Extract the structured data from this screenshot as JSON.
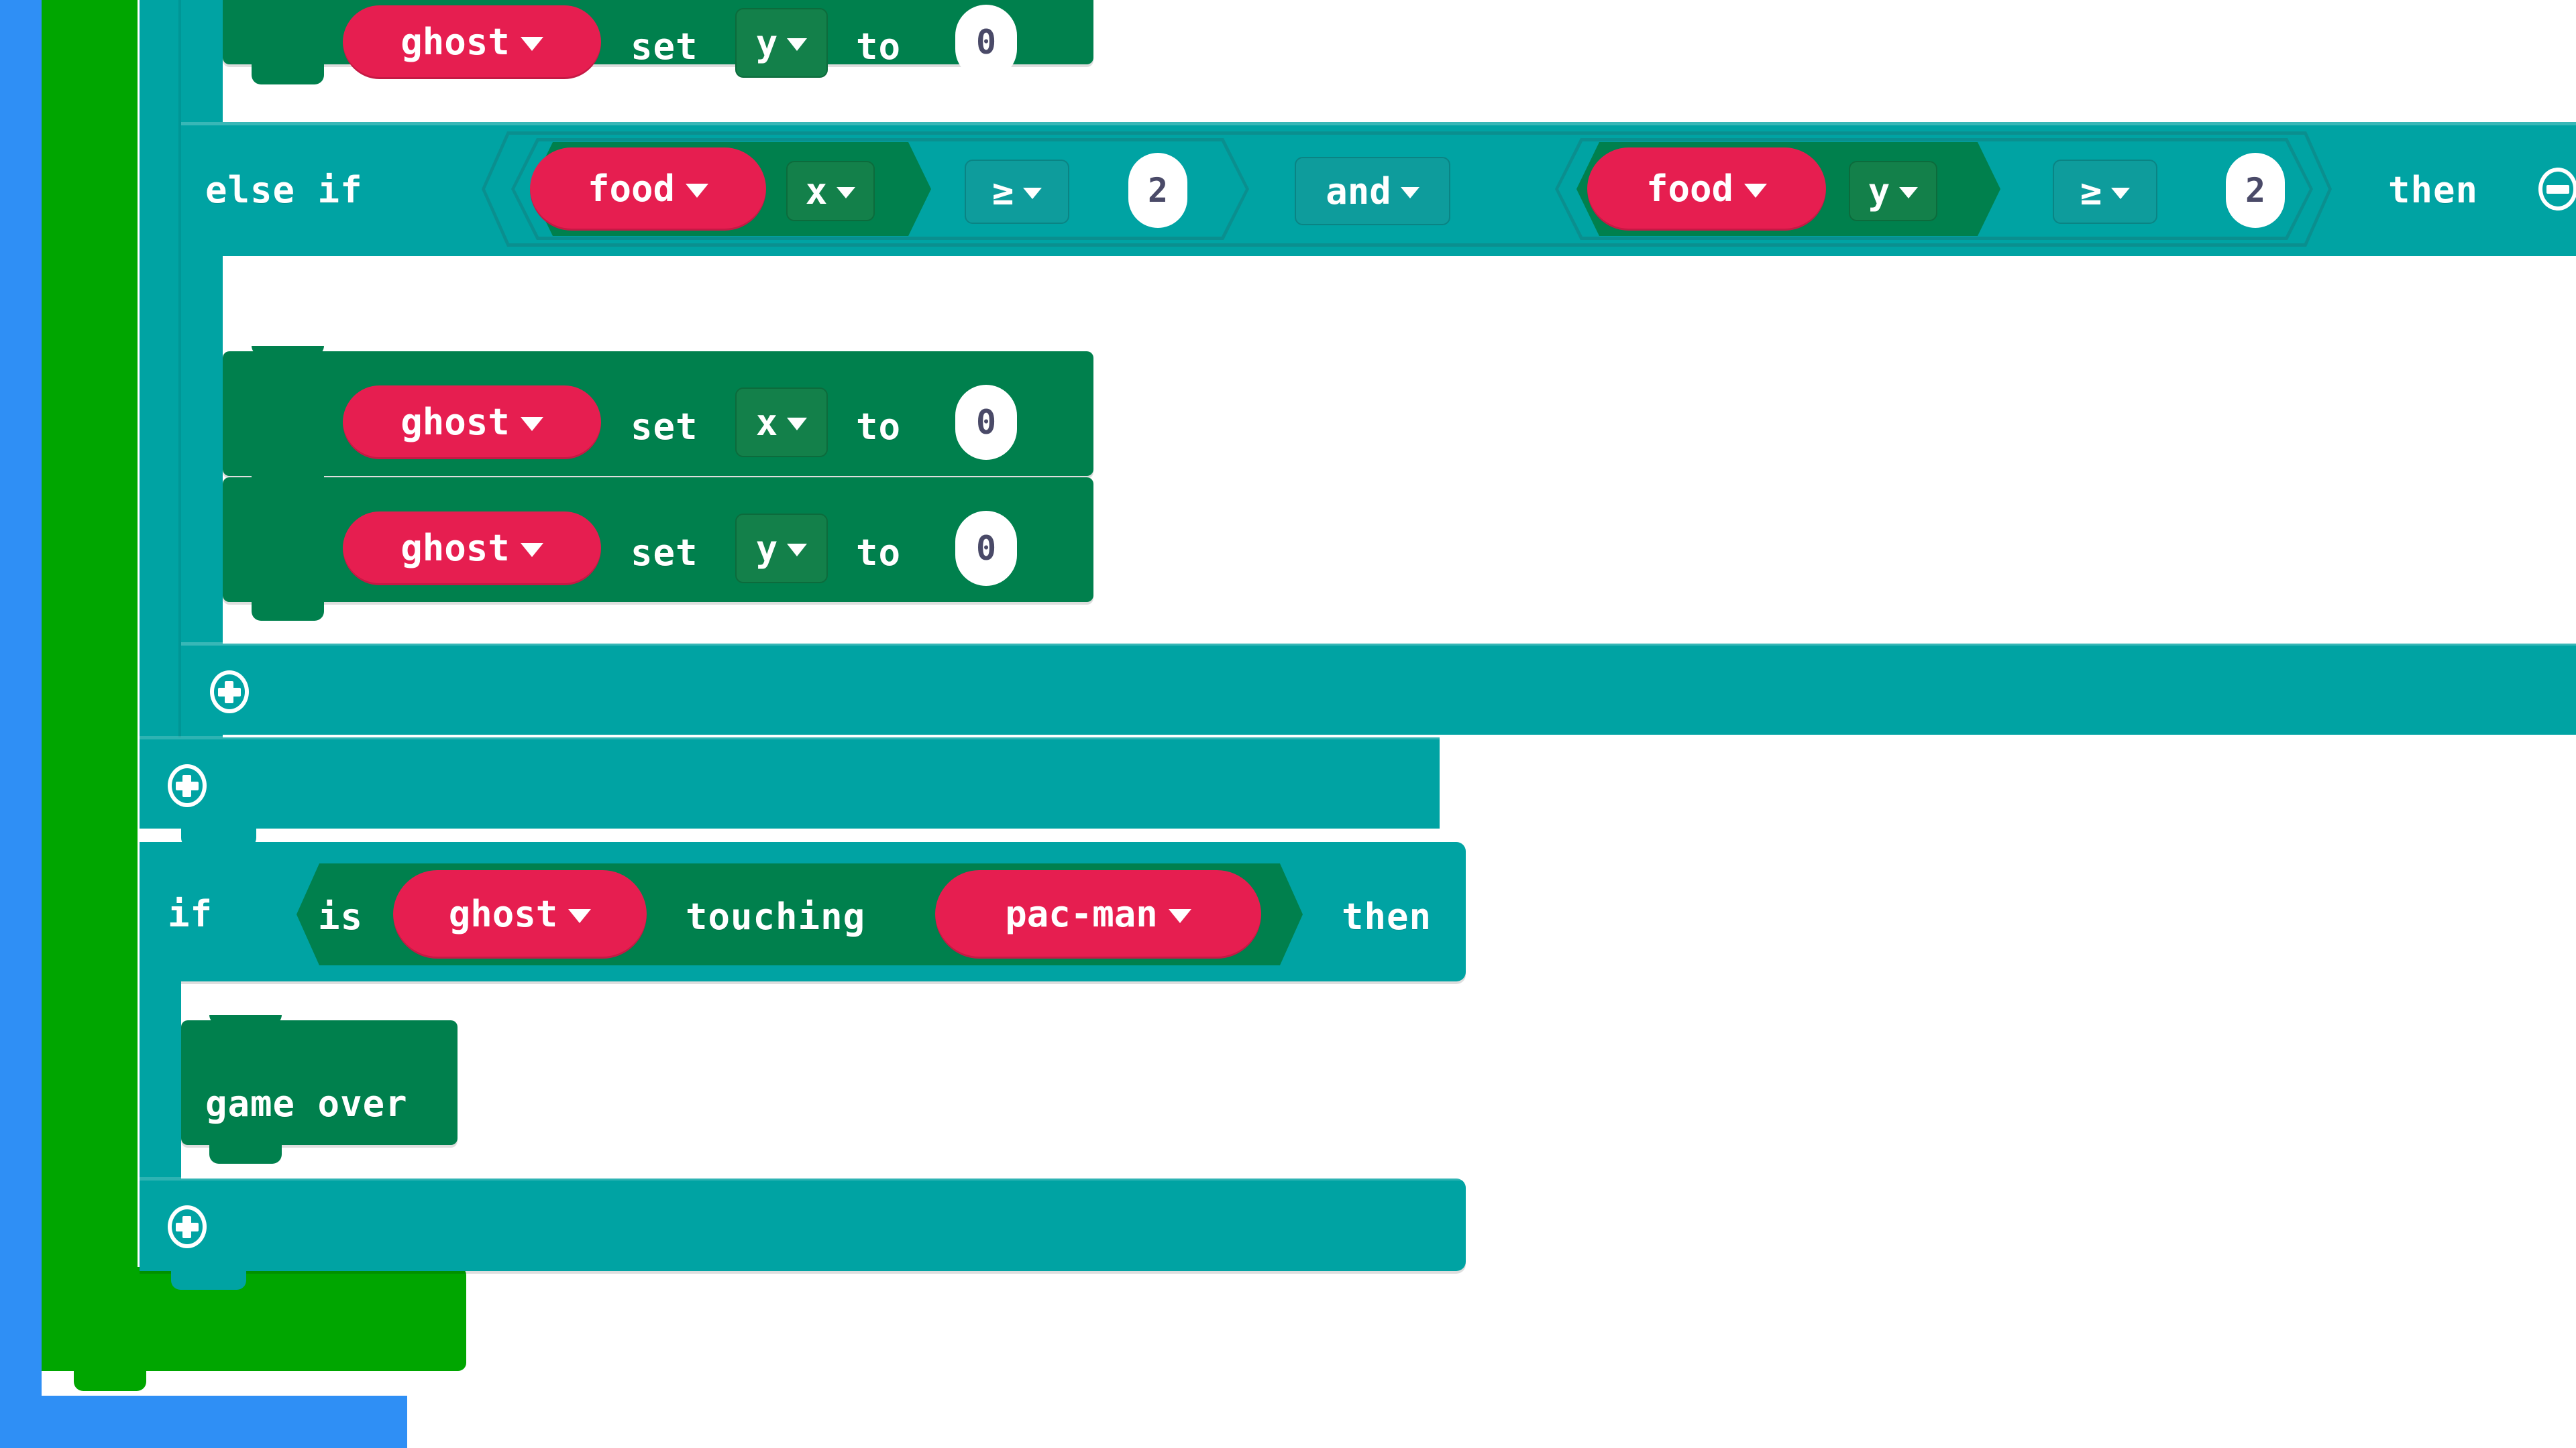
{
  "editor": {
    "name": "block-code-workspace",
    "colors": {
      "control_teal": "#00A3A3",
      "sprite_green": "#00804D",
      "loop_green": "#00A600",
      "event_blue": "#2F8FF5",
      "variable_red": "#E61E50",
      "field_white": "#FFFFFF",
      "number_text": "#4A4A68"
    }
  },
  "blocks": {
    "row_set_y_top": {
      "var": "ghost",
      "set_label": "set",
      "prop": "y",
      "to_label": "to",
      "value": "0"
    },
    "else_if_row": {
      "keyword": "else if",
      "then_label": "then",
      "remove_icon": "minus-circle-icon",
      "operand_a": {
        "var": "food",
        "prop": "x",
        "operator": "≥",
        "value": "2"
      },
      "joiner": "and",
      "operand_b": {
        "var": "food",
        "prop": "y",
        "operator": "≥",
        "value": "2"
      }
    },
    "row_set_x": {
      "var": "ghost",
      "set_label": "set",
      "prop": "x",
      "to_label": "to",
      "value": "0"
    },
    "row_set_y": {
      "var": "ghost",
      "set_label": "set",
      "prop": "y",
      "to_label": "to",
      "value": "0"
    },
    "add_icon_inner": "plus-circle-icon",
    "add_icon_outer": "plus-circle-icon",
    "if_touching_row": {
      "keyword": "if",
      "is_label": "is",
      "subject": "ghost",
      "touching_label": "touching",
      "target": "pac-man",
      "then_label": "then"
    },
    "game_over": {
      "label": "game over"
    },
    "add_icon_if": "plus-circle-icon"
  }
}
